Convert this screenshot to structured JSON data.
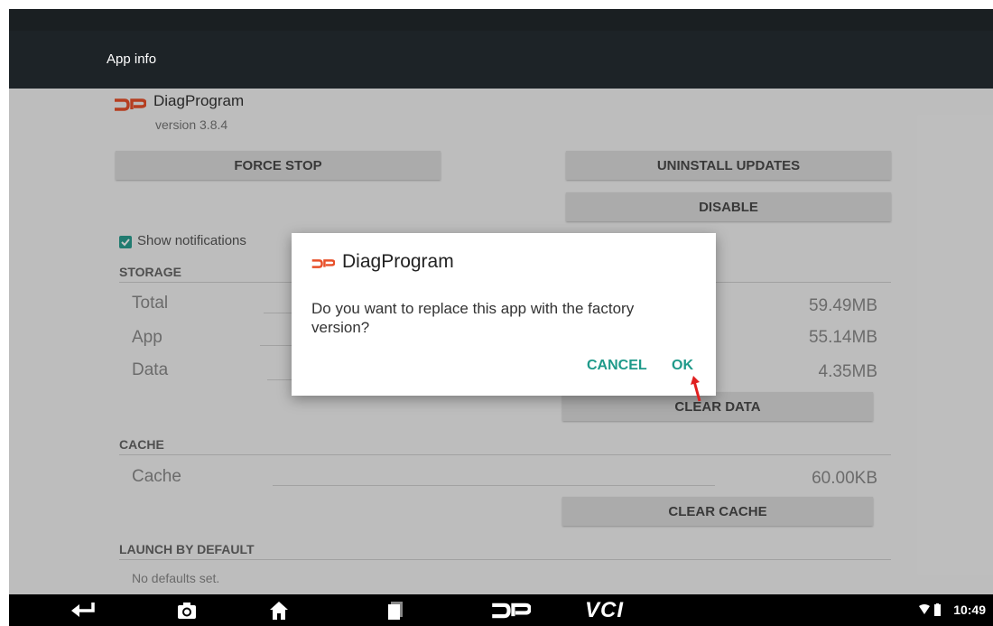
{
  "appbar": {
    "title": "App info"
  },
  "app": {
    "name": "DiagProgram",
    "version": "version 3.8.4"
  },
  "buttons": {
    "force_stop": "FORCE STOP",
    "uninstall_updates": "UNINSTALL UPDATES",
    "disable": "DISABLE",
    "clear_data": "CLEAR DATA",
    "clear_cache": "CLEAR CACHE"
  },
  "notifications": {
    "label": "Show notifications",
    "checked": true
  },
  "storage": {
    "header": "STORAGE",
    "rows": [
      {
        "label": "Total",
        "value": "59.49MB"
      },
      {
        "label": "App",
        "value": "55.14MB"
      },
      {
        "label": "Data",
        "value": "4.35MB"
      }
    ]
  },
  "cache": {
    "header": "CACHE",
    "label": "Cache",
    "value": "60.00KB"
  },
  "launch": {
    "header": "LAUNCH BY DEFAULT",
    "text": "No defaults set."
  },
  "dialog": {
    "title": "DiagProgram",
    "message": "Do you want to replace this app with the factory version?",
    "cancel": "CANCEL",
    "ok": "OK"
  },
  "navbar": {
    "items": [
      "back-icon",
      "camera-icon",
      "home-icon",
      "recents-icon",
      "dp-icon",
      "vci-icon"
    ],
    "vci_label": "VCI",
    "time": "10:49"
  },
  "colors": {
    "accent": "#1f9a8a",
    "brand": "#e8502a",
    "annotation_arrow": "#e02020"
  }
}
